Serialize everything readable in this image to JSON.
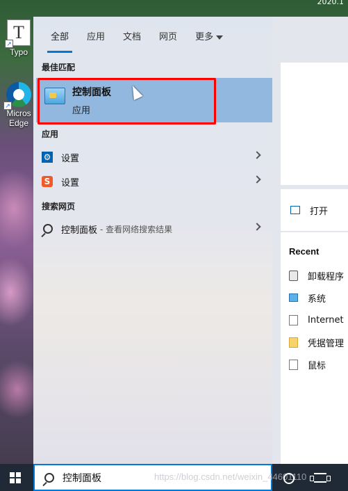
{
  "desktop": {
    "top_text": "2020.1",
    "icons": [
      {
        "label": "Typo",
        "glyph": "T"
      },
      {
        "label_line1": "Micros",
        "label_line2": "Edge"
      }
    ]
  },
  "tabs": [
    {
      "label": "全部",
      "active": true
    },
    {
      "label": "应用",
      "active": false
    },
    {
      "label": "文档",
      "active": false
    },
    {
      "label": "网页",
      "active": false
    },
    {
      "label": "更多",
      "active": false
    }
  ],
  "best_match": {
    "section": "最佳匹配",
    "title": "控制面板",
    "subtitle": "应用"
  },
  "apps": {
    "section": "应用",
    "items": [
      {
        "label": "设置",
        "icon": "settings-gear-icon"
      },
      {
        "label": "设置",
        "icon": "sogou-settings-icon",
        "glyph": "S"
      }
    ]
  },
  "web": {
    "section": "搜索网页",
    "item_label": "控制面板",
    "item_sub": "- 查看网络搜索结果"
  },
  "right_pane": {
    "open_label": "打开",
    "recent_title": "Recent",
    "recent_items": [
      "卸载程序",
      "系统",
      "Internet",
      "凭据管理",
      "鼠标"
    ]
  },
  "taskbar": {
    "search_value": "控制面板",
    "watermark": "https://blog.csdn.net/weixin_44601110"
  },
  "colors": {
    "accent": "#0078d7",
    "selected_bg": "#92b8df",
    "highlight_box": "#ff0000",
    "taskbar_bg": "#1f2a36"
  }
}
